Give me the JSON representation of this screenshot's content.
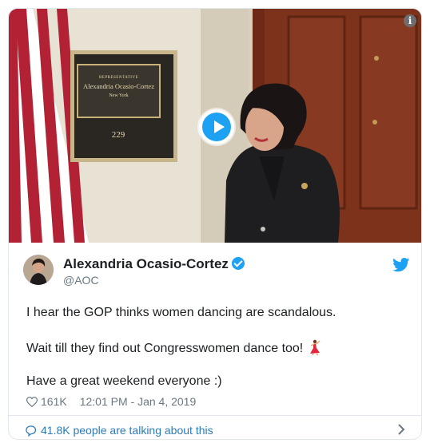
{
  "media": {
    "plaque": {
      "title": "REPRESENTATIVE",
      "name": "Alexandria Ocasio-Cortez",
      "state": "New York",
      "room": "229"
    },
    "info_icon": "info-icon",
    "play_icon": "play-icon"
  },
  "author": {
    "name": "Alexandria Ocasio-Cortez",
    "handle": "@AOC",
    "verified_icon": "verified-badge-icon",
    "logo_icon": "twitter-bird-icon"
  },
  "tweet": {
    "line1": "I hear the GOP thinks women dancing are scandalous.",
    "line2": "Wait till they find out Congresswomen dance too!",
    "line3": "Have a great weekend everyone :)"
  },
  "meta": {
    "likes": "161K",
    "timestamp": "12:01 PM - Jan 4, 2019"
  },
  "footer": {
    "talking": "41.8K people are talking about this"
  },
  "colors": {
    "accent": "#1da1f2",
    "link": "#2b7bb9",
    "muted": "#697882",
    "border": "#e1e8ed"
  }
}
